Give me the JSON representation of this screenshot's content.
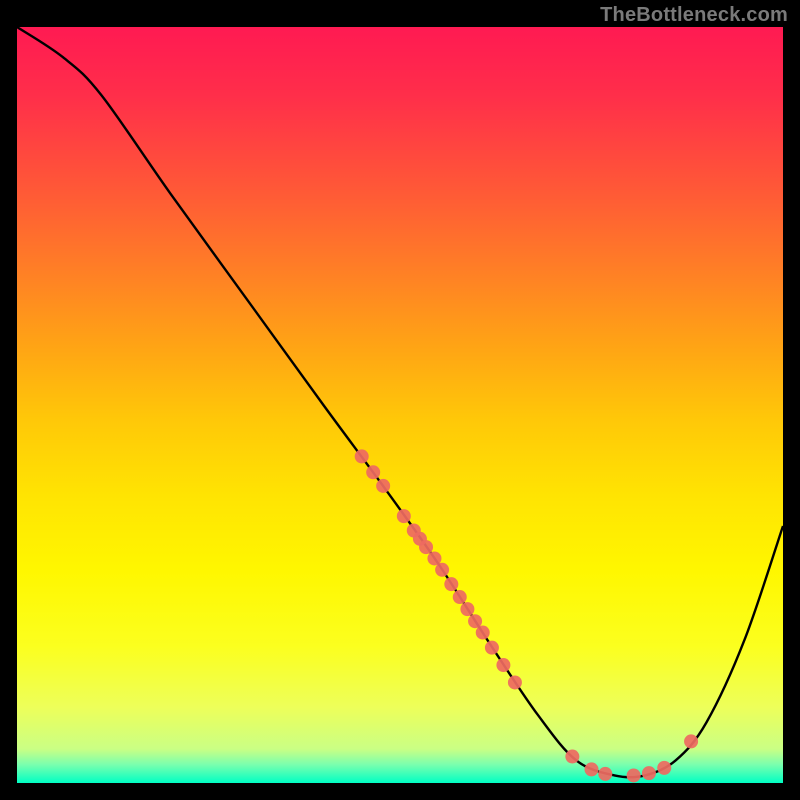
{
  "watermark": "TheBottleneck.com",
  "chart_data": {
    "type": "line",
    "title": "",
    "xlabel": "",
    "ylabel": "",
    "xlim": [
      0,
      100
    ],
    "ylim": [
      0,
      100
    ],
    "curve": {
      "name": "bottleneck-curve",
      "points": [
        {
          "x": 0,
          "y": 100
        },
        {
          "x": 6,
          "y": 96
        },
        {
          "x": 11,
          "y": 91
        },
        {
          "x": 20,
          "y": 78
        },
        {
          "x": 30,
          "y": 64
        },
        {
          "x": 40,
          "y": 50
        },
        {
          "x": 48,
          "y": 39
        },
        {
          "x": 55,
          "y": 29
        },
        {
          "x": 62,
          "y": 18
        },
        {
          "x": 68,
          "y": 9
        },
        {
          "x": 73,
          "y": 3
        },
        {
          "x": 78,
          "y": 1
        },
        {
          "x": 82,
          "y": 1
        },
        {
          "x": 86,
          "y": 3
        },
        {
          "x": 90,
          "y": 8
        },
        {
          "x": 95,
          "y": 19
        },
        {
          "x": 100,
          "y": 34
        }
      ]
    },
    "markers": {
      "name": "sample-points",
      "color": "#ee6a61",
      "points": [
        {
          "x": 45.0,
          "y": 43.2
        },
        {
          "x": 46.5,
          "y": 41.1
        },
        {
          "x": 47.8,
          "y": 39.3
        },
        {
          "x": 50.5,
          "y": 35.3
        },
        {
          "x": 51.8,
          "y": 33.4
        },
        {
          "x": 52.6,
          "y": 32.3
        },
        {
          "x": 53.4,
          "y": 31.2
        },
        {
          "x": 54.5,
          "y": 29.7
        },
        {
          "x": 55.5,
          "y": 28.2
        },
        {
          "x": 56.7,
          "y": 26.3
        },
        {
          "x": 57.8,
          "y": 24.6
        },
        {
          "x": 58.8,
          "y": 23.0
        },
        {
          "x": 59.8,
          "y": 21.4
        },
        {
          "x": 60.8,
          "y": 19.9
        },
        {
          "x": 62.0,
          "y": 17.9
        },
        {
          "x": 63.5,
          "y": 15.6
        },
        {
          "x": 65.0,
          "y": 13.3
        },
        {
          "x": 72.5,
          "y": 3.5
        },
        {
          "x": 75.0,
          "y": 1.8
        },
        {
          "x": 76.8,
          "y": 1.2
        },
        {
          "x": 80.5,
          "y": 1.0
        },
        {
          "x": 82.5,
          "y": 1.3
        },
        {
          "x": 84.5,
          "y": 2.0
        },
        {
          "x": 88.0,
          "y": 5.5
        }
      ]
    },
    "colors": {
      "gradient_top": "#ff1a52",
      "gradient_bottom": "#00ffc4",
      "curve": "#000000",
      "marker_fill": "#ee6a61"
    }
  }
}
